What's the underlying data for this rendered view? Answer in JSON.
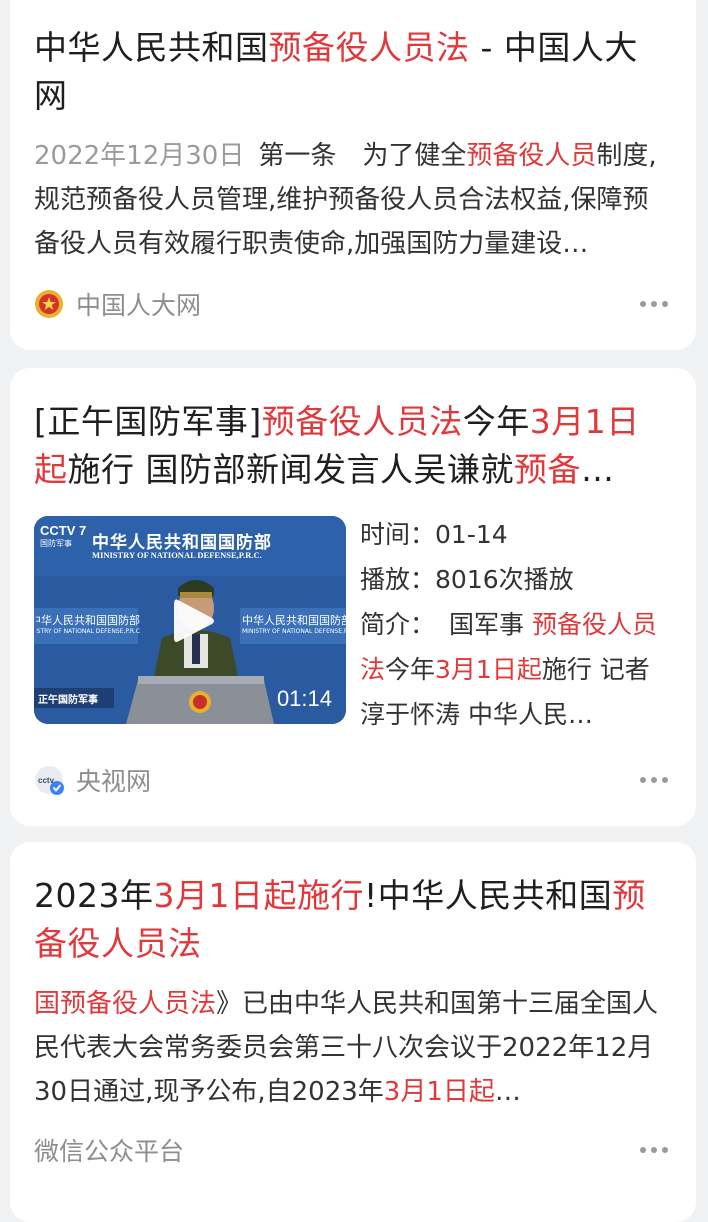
{
  "results": [
    {
      "title_parts": [
        {
          "text": "中华人民共和国",
          "hl": false
        },
        {
          "text": "预备役人员法",
          "hl": true
        },
        {
          "text": " - 中国人大网",
          "hl": false
        }
      ],
      "date": "2022年12月30日",
      "desc_parts": [
        {
          "text": "第一条　为了健全",
          "hl": false
        },
        {
          "text": "预备役人员",
          "hl": true
        },
        {
          "text": "制度,规范预备役人员管理,维护预备役人员合法权益,保障预备役人员有效履行职责使命,加强国防力量建设…",
          "hl": false
        }
      ],
      "source": "中国人大网"
    },
    {
      "title_parts": [
        {
          "text": "[正午国防军事]",
          "hl": false
        },
        {
          "text": "预备役人员法",
          "hl": true
        },
        {
          "text": "今年",
          "hl": false
        },
        {
          "text": "3月1日起",
          "hl": true
        },
        {
          "text": "施行 国防部新闻发言人吴谦就",
          "hl": false
        },
        {
          "text": "预备",
          "hl": true
        },
        {
          "text": "…",
          "hl": false
        }
      ],
      "video": {
        "channel": "CCTV 7",
        "channel_sub": "国防军事",
        "banner_cn": "中华人民共和国国防部",
        "banner_en": "MINISTRY OF NATIONAL DEFENSE,P.R.C.",
        "side_cn": "中华人民共和国国防部",
        "side_en": "MINISTRY OF NATIONAL DEFENSE,P.R.C.",
        "program": "正午国防军事",
        "duration": "01:14"
      },
      "time_label": "时间：",
      "time_value": "01-14",
      "plays_label": "播放：",
      "plays_value": "8016次播放",
      "intro_label": "简介：",
      "intro_parts": [
        {
          "text": "国军事 ",
          "hl": false
        },
        {
          "text": "预备役人员法",
          "hl": true
        },
        {
          "text": "今年",
          "hl": false
        },
        {
          "text": "3月1日起",
          "hl": true
        },
        {
          "text": "施行 记者淳于怀涛 中华人民…",
          "hl": false
        }
      ],
      "source": "央视网"
    },
    {
      "title_parts": [
        {
          "text": "2023年",
          "hl": false
        },
        {
          "text": "3月1日起施行",
          "hl": true
        },
        {
          "text": "!中华人民共和国",
          "hl": false
        },
        {
          "text": "预备役人员法",
          "hl": true
        }
      ],
      "desc_parts": [
        {
          "text": "国预备役人员法",
          "hl": true
        },
        {
          "text": "》已由中华人民共和国第十三届全国人民代表大会常务委员会第三十八次会议于2022年12月30日通过,现予公布,自2023年",
          "hl": false
        },
        {
          "text": "3月1日起",
          "hl": true
        },
        {
          "text": "…",
          "hl": false
        }
      ],
      "source": "微信公众平台"
    }
  ],
  "colors": {
    "highlight": "#e0393b",
    "page_bg": "#f1f2f4",
    "card_bg": "#ffffff"
  }
}
